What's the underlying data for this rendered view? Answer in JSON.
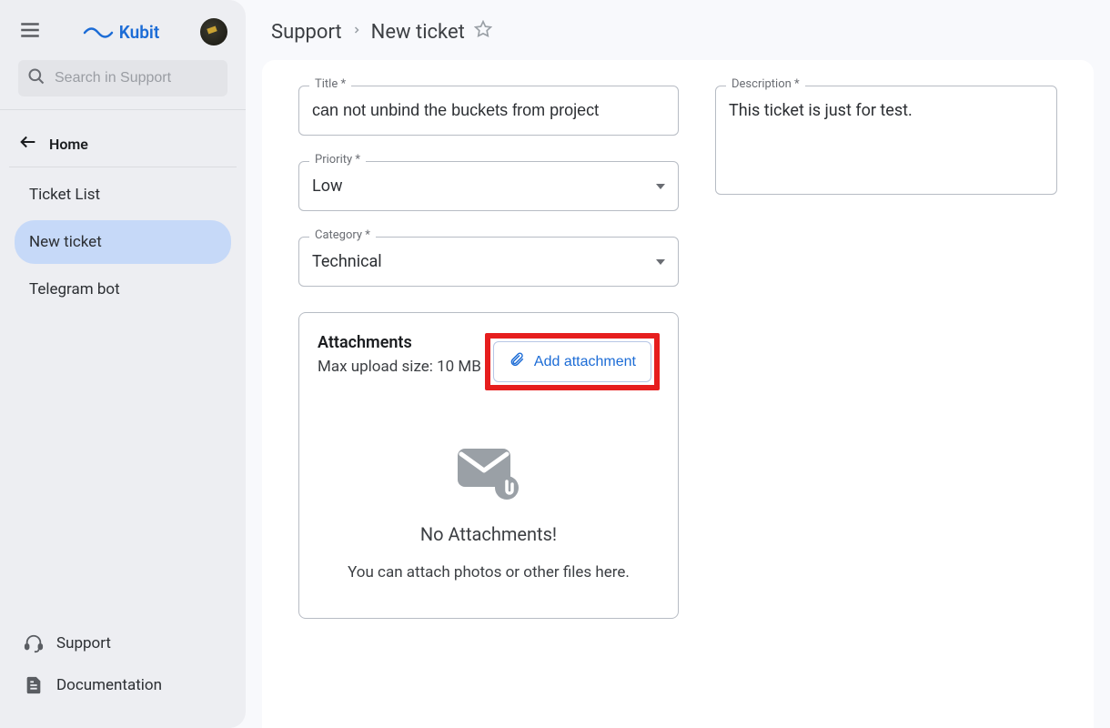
{
  "brand": {
    "name": "Kubit"
  },
  "search": {
    "placeholder": "Search in Support"
  },
  "sidebar": {
    "home": "Home",
    "items": [
      {
        "label": "Ticket List"
      },
      {
        "label": "New ticket"
      },
      {
        "label": "Telegram bot"
      }
    ],
    "bottom": [
      {
        "label": "Support"
      },
      {
        "label": "Documentation"
      }
    ]
  },
  "breadcrumb": {
    "parent": "Support",
    "current": "New ticket"
  },
  "form": {
    "title_label": "Title *",
    "title_value": "can not unbind the buckets from project",
    "priority_label": "Priority *",
    "priority_value": "Low",
    "category_label": "Category *",
    "category_value": "Technical",
    "description_label": "Description *",
    "description_value": "This ticket is just for test."
  },
  "attachments": {
    "title": "Attachments",
    "max_size": "Max upload size: 10 MB",
    "add_button": "Add attachment",
    "empty_title": "No Attachments!",
    "empty_hint": "You can attach photos or other files here."
  }
}
